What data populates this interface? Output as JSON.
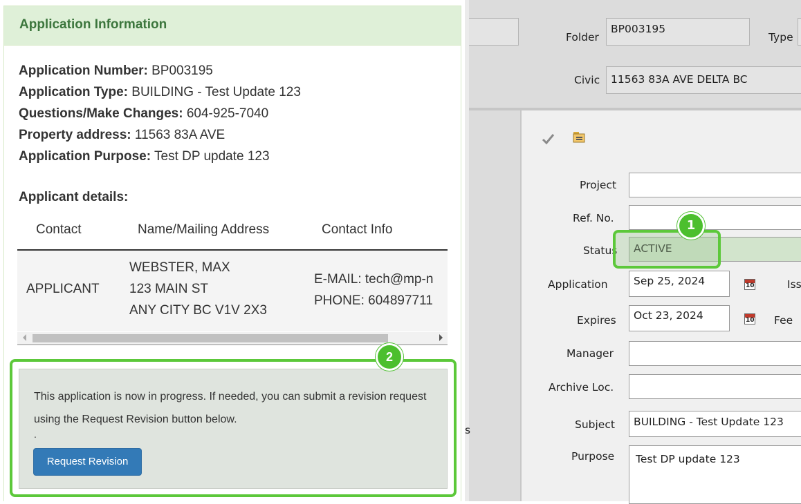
{
  "left_panel": {
    "heading": "Application Information",
    "info": [
      {
        "label": "Application Number:",
        "value": "BP003195"
      },
      {
        "label": "Application Type:",
        "value": "BUILDING - Test Update 123"
      },
      {
        "label": "Questions/Make Changes:",
        "value": "604-925-7040"
      },
      {
        "label": "Property address:",
        "value": "11563 83A AVE"
      },
      {
        "label": "Application Purpose:",
        "value": "Test DP update 123"
      }
    ],
    "applicant_title": "Applicant details:",
    "table": {
      "headers": [
        "Contact",
        "Name/Mailing Address",
        "Contact Info"
      ],
      "row": {
        "contact": "APPLICANT",
        "address_lines": [
          "WEBSTER, MAX",
          "123 MAIN ST",
          "ANY CITY BC V1V 2X3"
        ],
        "info_lines": [
          "E-MAIL: tech@mp-n",
          "PHONE: 604897711"
        ]
      }
    },
    "alert": {
      "text": "This application is now in progress. If needed, you can submit a revision request using the Request Revision button below.",
      "dot": ".",
      "button": "Request Revision"
    },
    "callout_2": "2"
  },
  "right_panel": {
    "folder_label": "Folder",
    "folder_value": "BP003195",
    "type_label": "Type",
    "civic_label": "Civic",
    "civic_value": "11563 83A AVE DELTA BC",
    "check_icon": "check-icon",
    "folder_icon": "folder-icon",
    "project_label": "Project",
    "project_value": "",
    "refno_label": "Ref. No.",
    "refno_value": "",
    "status_label": "Status",
    "status_value": "ACTIVE",
    "application_label": "Application",
    "application_value": "Sep 25, 2024",
    "iss_label": "Iss",
    "expires_label": "Expires",
    "expires_value": "Oct 23, 2024",
    "fee_label": "Fee",
    "calendar_day": "10",
    "manager_label": "Manager",
    "manager_value": "",
    "archive_label": "Archive Loc.",
    "archive_value": "",
    "subject_label": "Subject",
    "subject_value": "BUILDING - Test Update 123",
    "purpose_label": "Purpose",
    "purpose_value": "Test DP update 123",
    "side_s": "s",
    "callout_1": "1"
  },
  "colors": {
    "highlight": "#5cc83a",
    "heading_bg": "#dff0d8",
    "heading_text": "#3c763d",
    "button": "#337ab7"
  }
}
